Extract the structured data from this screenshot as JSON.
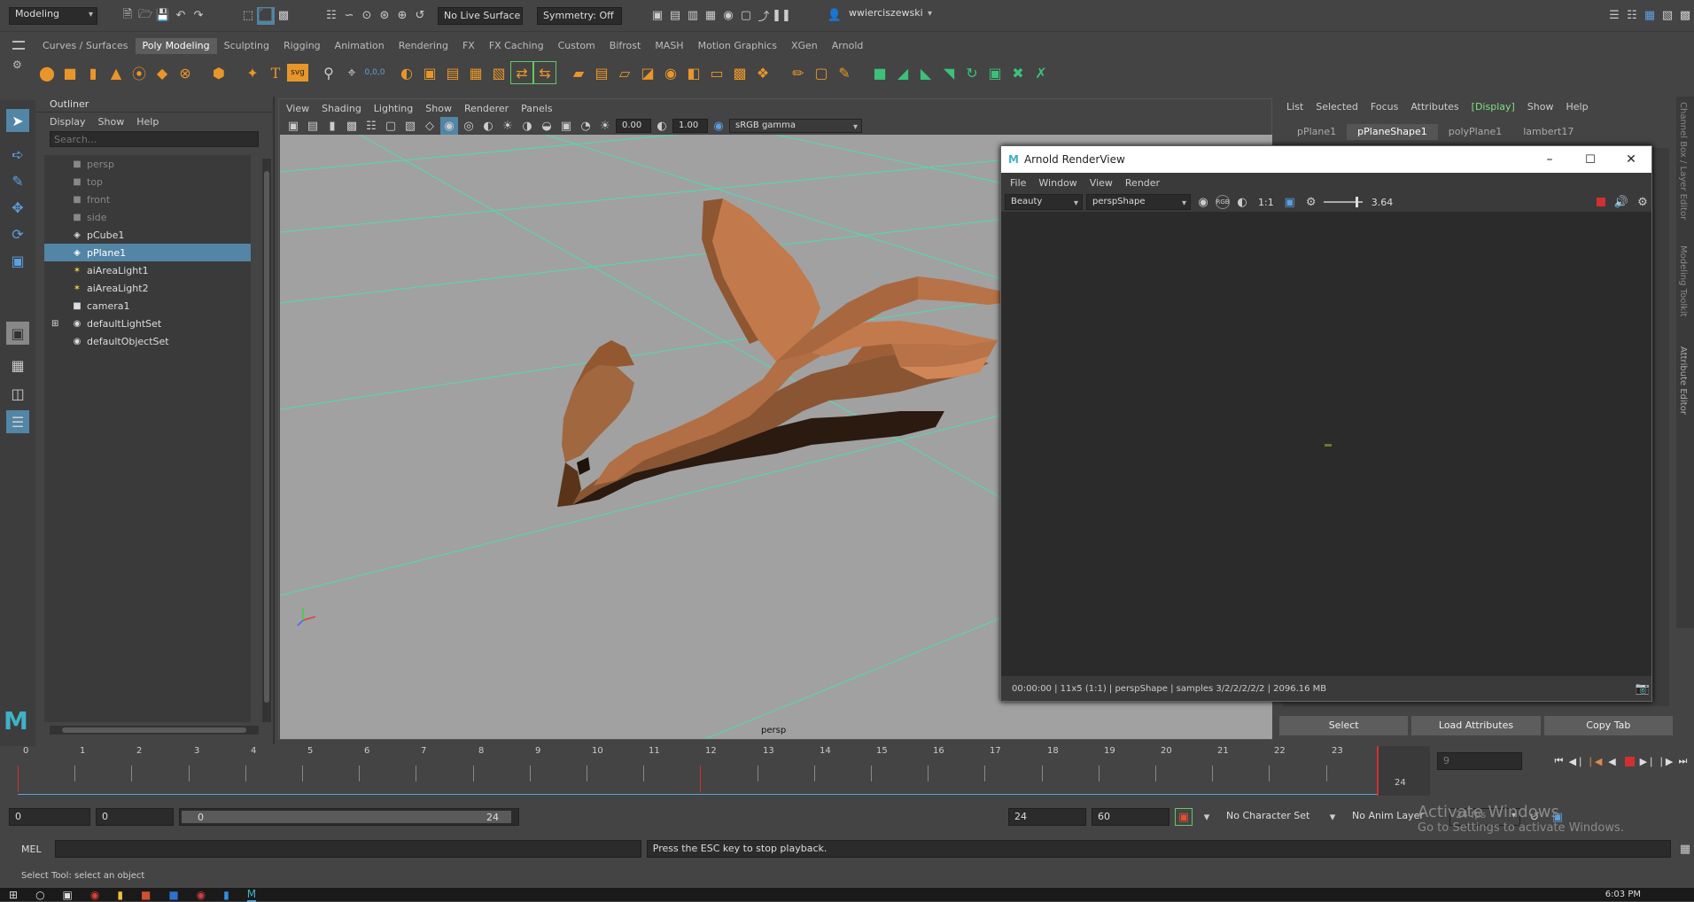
{
  "status_bar": {
    "workspace_dropdown": "Modeling",
    "live_surface": "No Live Surface",
    "symmetry": "Symmetry: Off",
    "user": "wwierciszewski"
  },
  "shelf_tabs": [
    "Curves / Surfaces",
    "Poly Modeling",
    "Sculpting",
    "Rigging",
    "Animation",
    "Rendering",
    "FX",
    "FX Caching",
    "Custom",
    "Bifrost",
    "MASH",
    "Motion Graphics",
    "XGen",
    "Arnold"
  ],
  "shelf_active": "Poly Modeling",
  "shelf_text_icons": {
    "type": "T",
    "svg": "svg",
    "num": "0,0,0"
  },
  "outliner": {
    "title": "Outliner",
    "menu": [
      "Display",
      "Show",
      "Help"
    ],
    "search_placeholder": "Search...",
    "items": [
      {
        "label": "persp",
        "icon": "camera-icon",
        "dim": true,
        "sel": false,
        "expand": false
      },
      {
        "label": "top",
        "icon": "camera-icon",
        "dim": true,
        "sel": false,
        "expand": false
      },
      {
        "label": "front",
        "icon": "camera-icon",
        "dim": true,
        "sel": false,
        "expand": false
      },
      {
        "label": "side",
        "icon": "camera-icon",
        "dim": true,
        "sel": false,
        "expand": false
      },
      {
        "label": "pCube1",
        "icon": "mesh-icon",
        "dim": false,
        "sel": false,
        "expand": false
      },
      {
        "label": "pPlane1",
        "icon": "mesh-icon",
        "dim": false,
        "sel": true,
        "expand": false
      },
      {
        "label": "aiAreaLight1",
        "icon": "light-icon",
        "dim": false,
        "sel": false,
        "expand": false
      },
      {
        "label": "aiAreaLight2",
        "icon": "light-icon",
        "dim": false,
        "sel": false,
        "expand": false
      },
      {
        "label": "camera1",
        "icon": "camera-icon",
        "dim": false,
        "sel": false,
        "expand": false
      },
      {
        "label": "defaultLightSet",
        "icon": "set-icon",
        "dim": false,
        "sel": false,
        "expand": true
      },
      {
        "label": "defaultObjectSet",
        "icon": "set-icon",
        "dim": false,
        "sel": false,
        "expand": false
      }
    ]
  },
  "viewport": {
    "menu": [
      "View",
      "Shading",
      "Lighting",
      "Show",
      "Renderer",
      "Panels"
    ],
    "exposure": "0.00",
    "gamma": "1.00",
    "color_space": "sRGB gamma",
    "camera_label": "persp"
  },
  "attr_editor": {
    "menu": [
      "List",
      "Selected",
      "Focus",
      "Attributes",
      "[Display]",
      "Show",
      "Help"
    ],
    "tabs": [
      "pPlane1",
      "pPlaneShape1",
      "polyPlane1",
      "lambert17"
    ],
    "active_tab": "pPlaneShape1",
    "buttons": [
      "Select",
      "Load Attributes",
      "Copy Tab"
    ]
  },
  "render_view": {
    "title": "Arnold RenderView",
    "menu": [
      "File",
      "Window",
      "View",
      "Render"
    ],
    "aov": "Beauty",
    "camera": "perspShape",
    "ratio": "1:1",
    "exposure": "3.64",
    "status": "00:00:00 | 11x5 (1:1) | perspShape | samples 3/2/2/2/2/2 | 2096.16 MB"
  },
  "timeline": {
    "frames": [
      "0",
      "1",
      "2",
      "3",
      "4",
      "5",
      "6",
      "7",
      "8",
      "9",
      "10",
      "11",
      "12",
      "13",
      "14",
      "15",
      "16",
      "17",
      "18",
      "19",
      "20",
      "21",
      "22",
      "23",
      "24"
    ],
    "current_frame": "24",
    "current_field": "9"
  },
  "range": {
    "start": "0",
    "anim_start": "0",
    "slider_start": "0",
    "slider_end": "24",
    "end": "24",
    "anim_end": "60",
    "char_set": "No Character Set",
    "anim_layer": "No Anim Layer",
    "fps": "24 fps"
  },
  "watermark": {
    "line1": "Activate Windows",
    "line2": "Go to Settings to activate Windows."
  },
  "command_line": {
    "lang": "MEL",
    "feedback": "Press the ESC key to stop playback."
  },
  "help_line": "Select Tool: select an object",
  "side_tabs": [
    "Channel Box / Layer Editor",
    "Modeling Toolkit",
    "Attribute Editor"
  ],
  "taskbar": {
    "time": "6:03 PM"
  }
}
